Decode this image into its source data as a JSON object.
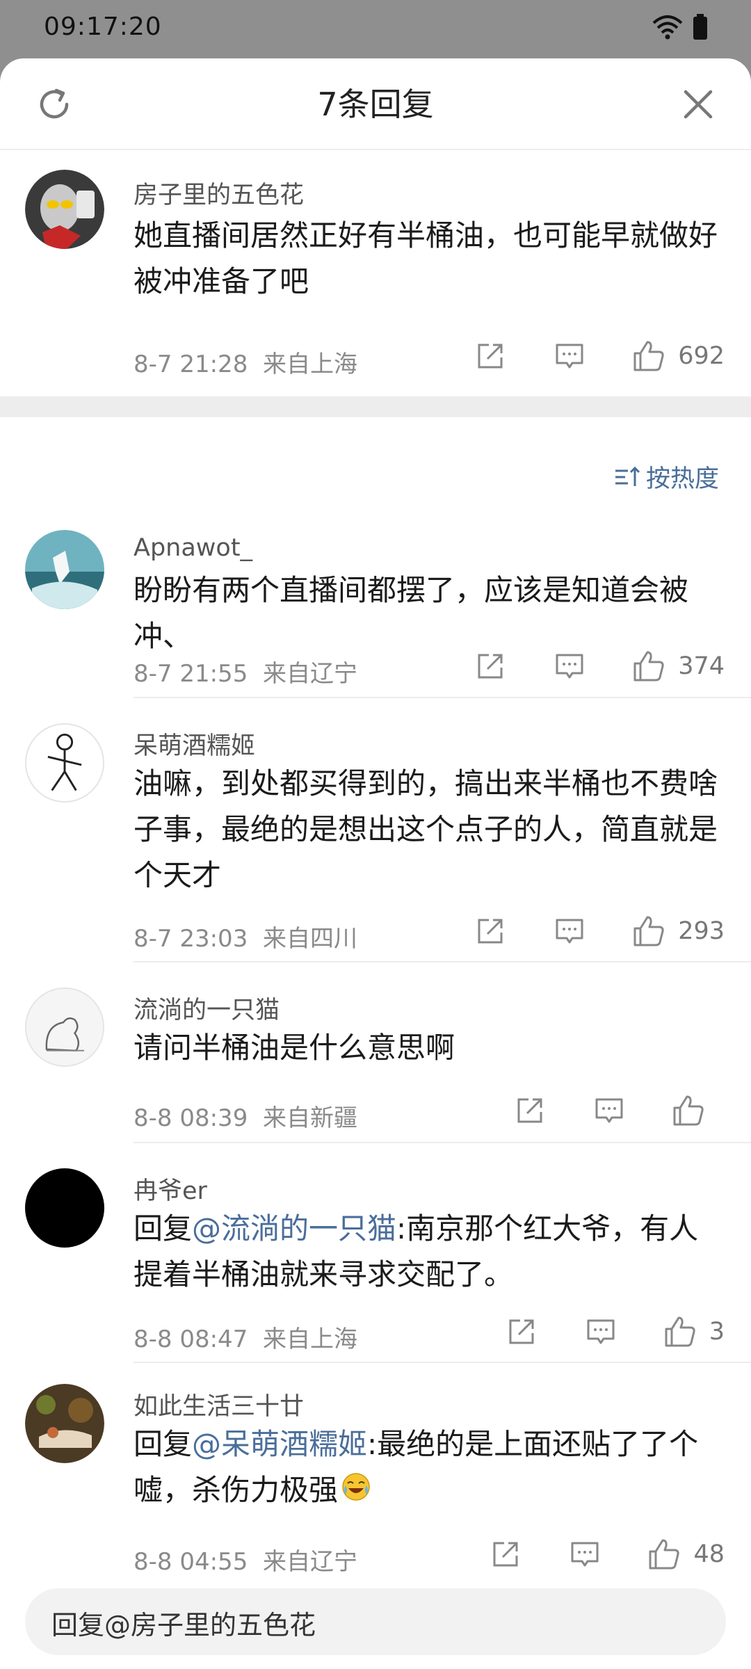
{
  "status_bar": {
    "time": "09:17:20"
  },
  "header": {
    "title": "7条回复"
  },
  "main_comment": {
    "username": "房子里的五色花",
    "text": "她直播间居然正好有半桶油，也可能早就做好被冲准备了吧",
    "date": "8-7 21:28",
    "location": "来自上海",
    "likes": "692"
  },
  "sort": {
    "label": "按热度"
  },
  "replies": [
    {
      "username": "Apnawot_",
      "text": "盼盼有两个直播间都摆了，应该是知道会被冲、",
      "date": "8-7 21:55",
      "location": "来自辽宁",
      "likes": "374"
    },
    {
      "username": "呆萌酒糯姬",
      "text": "油嘛，到处都买得到的，搞出来半桶也不费啥子事，最绝的是想出这个点子的人，简直就是个天才",
      "date": "8-7 23:03",
      "location": "来自四川",
      "likes": "293"
    },
    {
      "username": "流淌的一只猫",
      "text": "请问半桶油是什么意思啊",
      "date": "8-8 08:39",
      "location": "来自新疆",
      "likes": ""
    },
    {
      "username": "冉爷er",
      "prefix": "回复",
      "mention": "@流淌的一只猫",
      "text": ":南京那个红大爷，有人提着半桶油就来寻求交配了。",
      "date": "8-8 08:47",
      "location": "来自上海",
      "likes": "3"
    },
    {
      "username": "如此生活三十廿",
      "prefix": "回复",
      "mention": "@呆萌酒糯姬",
      "text": ":最绝的是上面还贴了了个嘘，杀伤力极强",
      "date": "8-8 04:55",
      "location": "来自辽宁",
      "likes": "48"
    }
  ],
  "reply_input": {
    "placeholder": "回复@房子里的五色花"
  },
  "colors": {
    "accent": "#4a6e9a",
    "background": "#ffffff",
    "gap": "#ededed"
  }
}
